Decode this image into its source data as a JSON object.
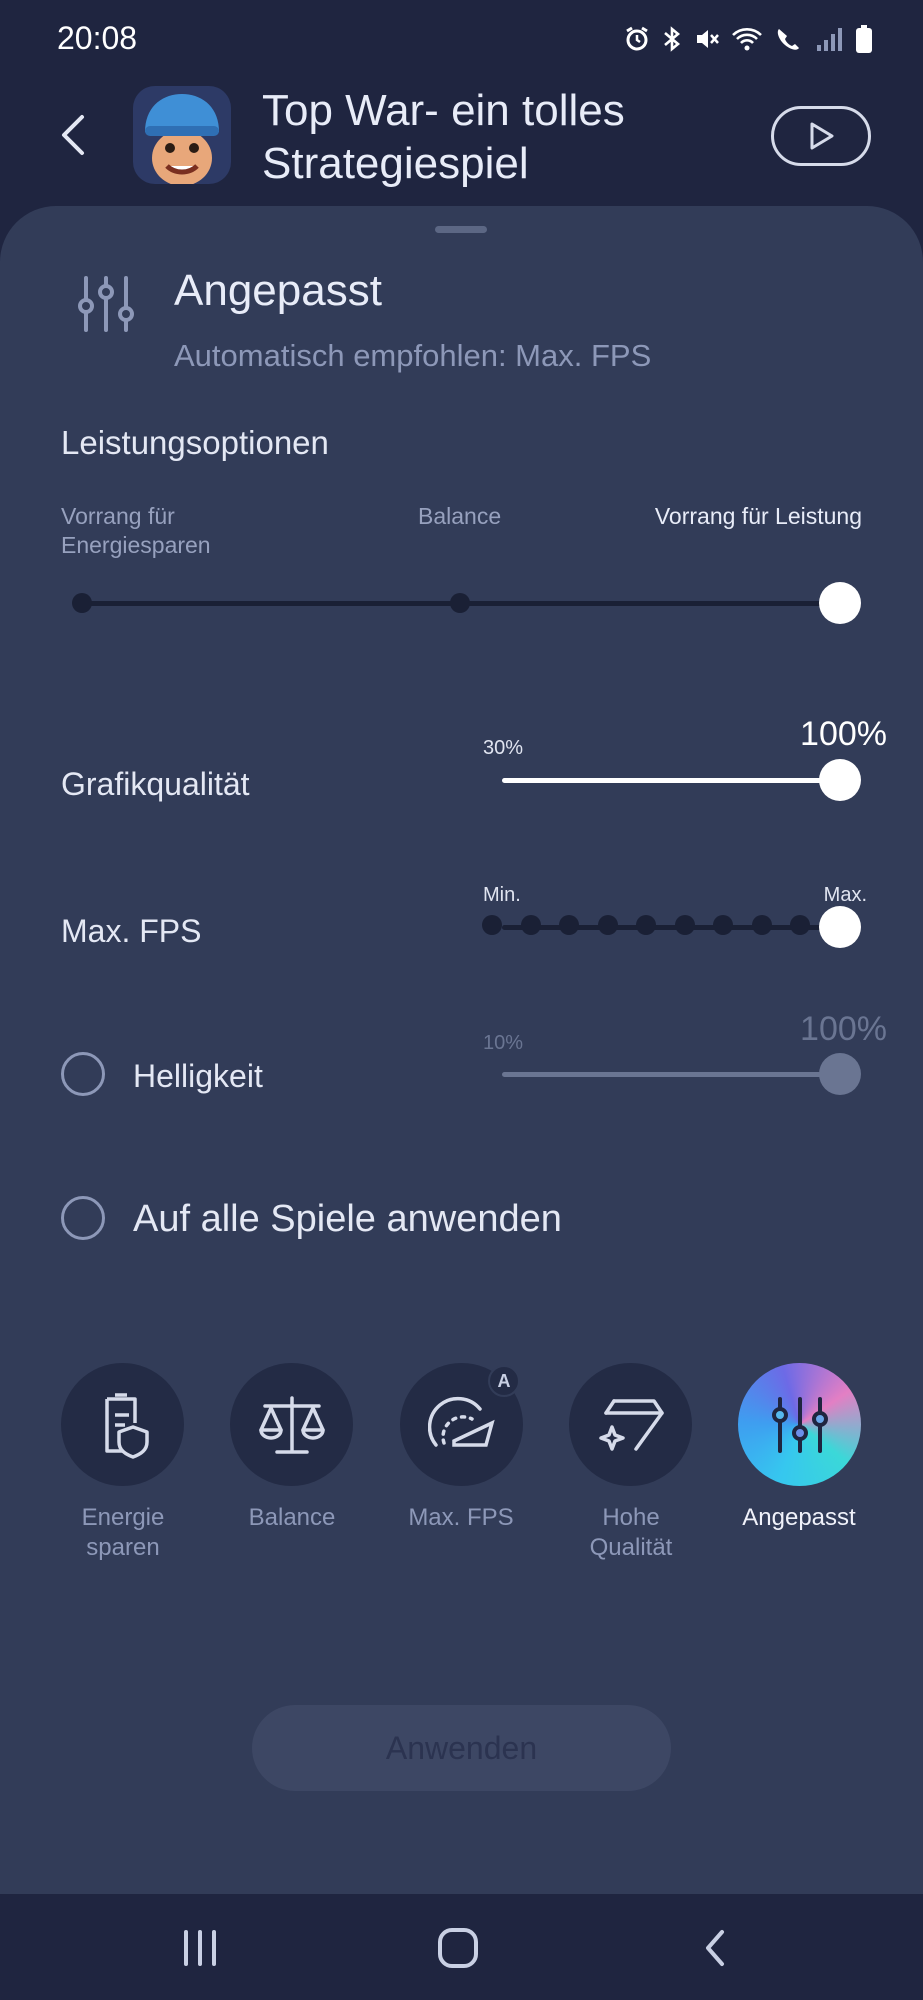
{
  "status_bar": {
    "time": "20:08"
  },
  "header": {
    "app_title_line1": "Top War- ein tolles",
    "app_title_line2": "Strategiespiel"
  },
  "mode": {
    "title": "Angepasst",
    "subtitle": "Automatisch empfohlen: Max. FPS"
  },
  "performance": {
    "section_title": "Leistungsoptionen",
    "option_left_line1": "Vorrang für",
    "option_left_line2": "Energiesparen",
    "option_middle": "Balance",
    "option_right": "Vorrang für Leistung",
    "selected_index": 2
  },
  "graphics": {
    "label": "Grafikqualität",
    "min_label": "30%",
    "value_label": "100%",
    "value_percent": 100
  },
  "fps": {
    "label": "Max. FPS",
    "min_label": "Min.",
    "max_label": "Max.",
    "steps": 10,
    "selected_step": 10
  },
  "brightness": {
    "label": "Helligkeit",
    "min_label": "10%",
    "value_label": "100%",
    "value_percent": 100,
    "enabled": false
  },
  "apply_all": {
    "label": "Auf alle Spiele anwenden",
    "checked": false
  },
  "modes": [
    {
      "label_line1": "Energie",
      "label_line2": "sparen",
      "icon": "battery-shield-icon"
    },
    {
      "label_line1": "Balance",
      "label_line2": "",
      "icon": "scale-icon"
    },
    {
      "label_line1": "Max. FPS",
      "label_line2": "",
      "icon": "speedometer-icon",
      "badge": "A"
    },
    {
      "label_line1": "Hohe",
      "label_line2": "Qualität",
      "icon": "diamond-sparkle-icon"
    },
    {
      "label_line1": "Angepasst",
      "label_line2": "",
      "icon": "sliders-icon",
      "active": true
    }
  ],
  "apply_button": {
    "label": "Anwenden"
  },
  "colors": {
    "background": "#1f2540",
    "sheet": "#323c58",
    "accent_gradient_start": "#36c7ef",
    "accent_gradient_end": "#e37fc4"
  }
}
